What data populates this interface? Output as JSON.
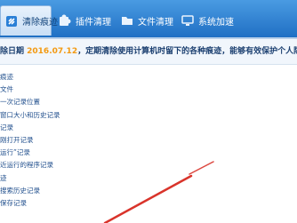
{
  "toolbar": {
    "tabs": [
      {
        "label": "清除痕迹",
        "icon": "broom-icon",
        "active": true
      },
      {
        "label": "插件清理",
        "icon": "puzzle-icon",
        "active": false
      },
      {
        "label": "文件清理",
        "icon": "folder-icon",
        "active": false
      },
      {
        "label": "系统加速",
        "icon": "monitor-icon",
        "active": false
      }
    ]
  },
  "header": {
    "prefix": "除日期 ",
    "date": "2016.07.12",
    "suffix": "，定期清除使用计算机时留下的各种痕迹，能够有效保护个人隐"
  },
  "items": [
    "痕迹",
    "文件",
    "一次记录位置",
    "窗口大小和历史记录",
    "记录",
    "刚打开记录",
    "运行”记录",
    "近运行的程序记录",
    "迹",
    "搜索历史记录",
    "保存记录",
    ""
  ],
  "colors": {
    "toolbar_top": "#4a9be2",
    "toolbar_bottom": "#1f6fc4",
    "date": "#f39a12",
    "text": "#1f4e8c",
    "arrow": "#d9342b"
  }
}
